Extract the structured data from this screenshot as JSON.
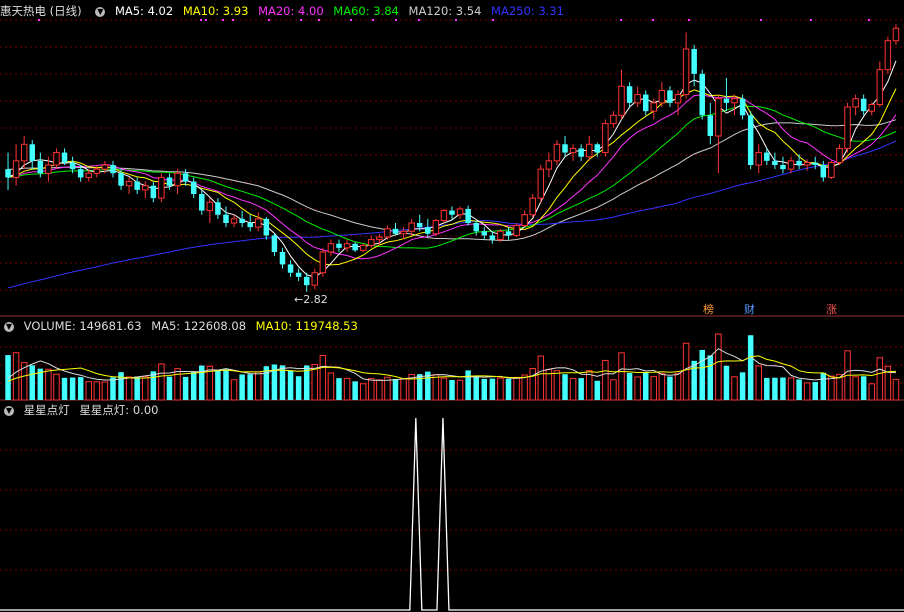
{
  "main_panel": {
    "title": "惠天热电 (日线)",
    "ma": [
      {
        "label": "MA5: 4.02",
        "color": "#ffffff"
      },
      {
        "label": "MA10: 3.93",
        "color": "#ffff00"
      },
      {
        "label": "MA20: 4.00",
        "color": "#ff33ff"
      },
      {
        "label": "MA60: 3.84",
        "color": "#00ee00"
      },
      {
        "label": "MA120: 3.54",
        "color": "#cccccc"
      },
      {
        "label": "MA250: 3.31",
        "color": "#3333ff"
      }
    ],
    "low_marker": "2.82",
    "tags": [
      {
        "text": "榜",
        "color": "#ff9933"
      },
      {
        "text": "财",
        "color": "#5599ff"
      },
      {
        "text": "涨",
        "color": "#ff5555"
      }
    ]
  },
  "volume_panel": {
    "items": [
      {
        "label": "VOLUME: 149681.63",
        "color": "#dddddd"
      },
      {
        "label": "MA5: 122608.08",
        "color": "#dddddd"
      },
      {
        "label": "MA10: 119748.53",
        "color": "#ffff00"
      }
    ]
  },
  "indicator_panel": {
    "items": [
      {
        "label": "星星点灯",
        "color": "#dddddd"
      },
      {
        "label": "星星点灯: 0.00",
        "color": "#dddddd"
      }
    ]
  },
  "colors": {
    "up": "#ff3333",
    "down": "#44ffff",
    "grid": "#7a0000",
    "divider": "#993333"
  },
  "chart_data": {
    "type": "candlestick",
    "title": "惠天热电 (日线)",
    "price_range": [
      2.6,
      6.1
    ],
    "ohlc": [
      [
        4.3,
        4.5,
        4.05,
        4.2
      ],
      [
        4.2,
        4.6,
        4.1,
        4.4
      ],
      [
        4.4,
        4.7,
        4.3,
        4.6
      ],
      [
        4.6,
        4.65,
        4.3,
        4.4
      ],
      [
        4.4,
        4.5,
        4.2,
        4.25
      ],
      [
        4.25,
        4.45,
        4.15,
        4.35
      ],
      [
        4.35,
        4.55,
        4.3,
        4.5
      ],
      [
        4.5,
        4.55,
        4.35,
        4.38
      ],
      [
        4.38,
        4.45,
        4.25,
        4.3
      ],
      [
        4.3,
        4.35,
        4.15,
        4.2
      ],
      [
        4.2,
        4.3,
        4.15,
        4.25
      ],
      [
        4.25,
        4.35,
        4.2,
        4.3
      ],
      [
        4.3,
        4.4,
        4.25,
        4.35
      ],
      [
        4.35,
        4.4,
        4.2,
        4.25
      ],
      [
        4.25,
        4.3,
        4.05,
        4.1
      ],
      [
        4.1,
        4.2,
        4.0,
        4.15
      ],
      [
        4.15,
        4.2,
        4.0,
        4.05
      ],
      [
        4.05,
        4.15,
        3.95,
        4.1
      ],
      [
        4.1,
        4.15,
        3.9,
        3.95
      ],
      [
        3.95,
        4.25,
        3.9,
        4.2
      ],
      [
        4.2,
        4.25,
        4.05,
        4.1
      ],
      [
        4.1,
        4.3,
        4.0,
        4.25
      ],
      [
        4.25,
        4.3,
        4.1,
        4.15
      ],
      [
        4.15,
        4.2,
        3.95,
        4.0
      ],
      [
        4.0,
        4.05,
        3.75,
        3.8
      ],
      [
        3.8,
        3.95,
        3.65,
        3.9
      ],
      [
        3.9,
        3.95,
        3.7,
        3.75
      ],
      [
        3.75,
        3.85,
        3.6,
        3.65
      ],
      [
        3.65,
        3.75,
        3.6,
        3.7
      ],
      [
        3.7,
        3.8,
        3.6,
        3.65
      ],
      [
        3.65,
        3.75,
        3.55,
        3.6
      ],
      [
        3.6,
        3.78,
        3.55,
        3.7
      ],
      [
        3.7,
        3.72,
        3.45,
        3.5
      ],
      [
        3.5,
        3.52,
        3.25,
        3.3
      ],
      [
        3.3,
        3.35,
        3.1,
        3.15
      ],
      [
        3.15,
        3.2,
        3.0,
        3.05
      ],
      [
        3.05,
        3.1,
        2.95,
        3.0
      ],
      [
        3.0,
        3.05,
        2.82,
        2.9
      ],
      [
        2.9,
        3.1,
        2.85,
        3.05
      ],
      [
        3.05,
        3.35,
        3.0,
        3.3
      ],
      [
        3.3,
        3.45,
        3.25,
        3.4
      ],
      [
        3.4,
        3.45,
        3.3,
        3.35
      ],
      [
        3.35,
        3.45,
        3.3,
        3.4
      ],
      [
        3.4,
        3.42,
        3.3,
        3.32
      ],
      [
        3.32,
        3.4,
        3.3,
        3.38
      ],
      [
        3.38,
        3.5,
        3.35,
        3.45
      ],
      [
        3.45,
        3.52,
        3.38,
        3.48
      ],
      [
        3.48,
        3.62,
        3.45,
        3.58
      ],
      [
        3.58,
        3.65,
        3.5,
        3.52
      ],
      [
        3.52,
        3.6,
        3.45,
        3.55
      ],
      [
        3.55,
        3.7,
        3.5,
        3.65
      ],
      [
        3.65,
        3.75,
        3.55,
        3.6
      ],
      [
        3.6,
        3.7,
        3.48,
        3.52
      ],
      [
        3.52,
        3.7,
        3.5,
        3.68
      ],
      [
        3.68,
        3.82,
        3.65,
        3.8
      ],
      [
        3.8,
        3.85,
        3.7,
        3.75
      ],
      [
        3.75,
        3.85,
        3.7,
        3.82
      ],
      [
        3.82,
        3.86,
        3.62,
        3.65
      ],
      [
        3.65,
        3.68,
        3.5,
        3.55
      ],
      [
        3.55,
        3.6,
        3.45,
        3.5
      ],
      [
        3.5,
        3.55,
        3.4,
        3.45
      ],
      [
        3.45,
        3.58,
        3.42,
        3.55
      ],
      [
        3.55,
        3.6,
        3.45,
        3.5
      ],
      [
        3.5,
        3.65,
        3.48,
        3.62
      ],
      [
        3.62,
        3.8,
        3.6,
        3.75
      ],
      [
        3.75,
        4.0,
        3.72,
        3.95
      ],
      [
        3.95,
        4.35,
        3.9,
        4.3
      ],
      [
        4.3,
        4.5,
        4.2,
        4.4
      ],
      [
        4.4,
        4.65,
        4.35,
        4.6
      ],
      [
        4.6,
        4.7,
        4.45,
        4.5
      ],
      [
        4.5,
        4.6,
        4.4,
        4.55
      ],
      [
        4.55,
        4.6,
        4.4,
        4.45
      ],
      [
        4.45,
        4.7,
        4.4,
        4.6
      ],
      [
        4.6,
        4.62,
        4.45,
        4.5
      ],
      [
        4.5,
        4.9,
        4.45,
        4.85
      ],
      [
        4.85,
        5.0,
        4.8,
        4.95
      ],
      [
        4.95,
        5.5,
        4.9,
        5.3
      ],
      [
        5.3,
        5.35,
        5.05,
        5.1
      ],
      [
        5.1,
        5.3,
        5.05,
        5.2
      ],
      [
        5.2,
        5.25,
        4.95,
        5.0
      ],
      [
        5.0,
        5.15,
        4.9,
        5.1
      ],
      [
        5.1,
        5.35,
        5.05,
        5.25
      ],
      [
        5.25,
        5.3,
        5.05,
        5.1
      ],
      [
        5.1,
        5.25,
        4.95,
        5.2
      ],
      [
        5.2,
        5.95,
        5.15,
        5.75
      ],
      [
        5.75,
        5.8,
        5.3,
        5.45
      ],
      [
        5.45,
        5.5,
        4.9,
        4.95
      ],
      [
        4.95,
        5.1,
        4.6,
        4.7
      ],
      [
        4.7,
        5.2,
        4.25,
        5.15
      ],
      [
        5.15,
        5.4,
        5.0,
        5.1
      ],
      [
        5.1,
        5.2,
        4.95,
        5.15
      ],
      [
        5.15,
        5.2,
        4.9,
        4.95
      ],
      [
        4.95,
        5.0,
        4.3,
        4.35
      ],
      [
        4.35,
        4.6,
        4.25,
        4.5
      ],
      [
        4.5,
        4.55,
        4.35,
        4.4
      ],
      [
        4.4,
        4.5,
        4.3,
        4.35
      ],
      [
        4.35,
        4.45,
        4.25,
        4.3
      ],
      [
        4.3,
        4.45,
        4.25,
        4.4
      ],
      [
        4.4,
        4.48,
        4.3,
        4.35
      ],
      [
        4.35,
        4.42,
        4.28,
        4.38
      ],
      [
        4.38,
        4.45,
        4.3,
        4.35
      ],
      [
        4.35,
        4.4,
        4.15,
        4.2
      ],
      [
        4.2,
        4.4,
        4.18,
        4.38
      ],
      [
        4.38,
        4.6,
        4.35,
        4.55
      ],
      [
        4.55,
        5.1,
        4.5,
        5.05
      ],
      [
        5.05,
        5.2,
        4.95,
        5.15
      ],
      [
        5.15,
        5.2,
        4.95,
        5.0
      ],
      [
        5.0,
        5.1,
        4.95,
        5.08
      ],
      [
        5.08,
        5.6,
        5.05,
        5.5
      ],
      [
        5.5,
        5.9,
        5.45,
        5.85
      ],
      [
        5.85,
        6.05,
        5.8,
        6.0
      ]
    ],
    "volume_scale_max": 250000,
    "indicator": {
      "name": "星星点灯",
      "value": 0.0,
      "spikes": [
        0.46,
        0.49
      ]
    }
  }
}
